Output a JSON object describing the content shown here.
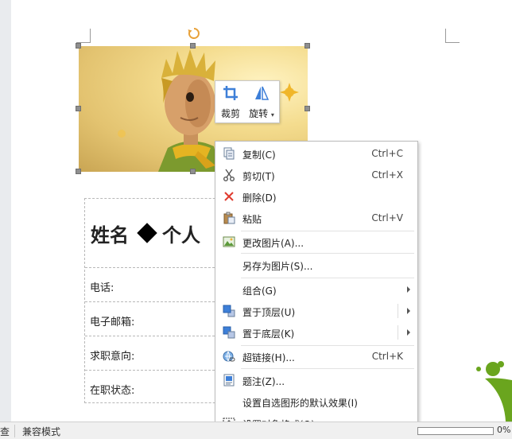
{
  "toolbar": {
    "crop_label": "裁剪",
    "rotate_label": "旋转"
  },
  "document": {
    "title_name": "姓名",
    "title_rest": "个人",
    "rows": [
      {
        "label": "电话:"
      },
      {
        "label": "电子邮箱:"
      },
      {
        "label": "求职意向:"
      },
      {
        "label": "在职状态:"
      }
    ]
  },
  "context_menu": {
    "items": [
      {
        "label": "复制(C)",
        "shortcut": "Ctrl+C",
        "icon": "copy-icon"
      },
      {
        "label": "剪切(T)",
        "shortcut": "Ctrl+X",
        "icon": "scissors-icon"
      },
      {
        "label": "删除(D)",
        "shortcut": "",
        "icon": "delete-x-icon"
      },
      {
        "label": "粘贴",
        "shortcut": "Ctrl+V",
        "icon": "paste-icon"
      },
      {
        "label": "更改图片(A)...",
        "shortcut": "",
        "icon": "change-picture-icon"
      },
      {
        "label": "另存为图片(S)...",
        "shortcut": "",
        "icon": ""
      },
      {
        "label": "组合(G)",
        "shortcut": "",
        "icon": ""
      },
      {
        "label": "置于顶层(U)",
        "shortcut": "",
        "icon": "bring-to-front-icon"
      },
      {
        "label": "置于底层(K)",
        "shortcut": "",
        "icon": "send-to-back-icon"
      },
      {
        "label": "超链接(H)...",
        "shortcut": "Ctrl+K",
        "icon": "hyperlink-icon"
      },
      {
        "label": "题注(Z)...",
        "shortcut": "",
        "icon": "caption-icon"
      },
      {
        "label": "设置自选图形的默认效果(I)",
        "shortcut": "",
        "icon": ""
      },
      {
        "label": "设置对象格式(O)...",
        "shortcut": "",
        "icon": "format-object-icon"
      }
    ]
  },
  "statusbar": {
    "left_fragment": "查",
    "mode": "兼容模式",
    "zoom_percent": "0%"
  },
  "colors": {
    "accent_blue": "#3d7fd8",
    "rotate_orange": "#e8a13a",
    "delete_red": "#e03b2f",
    "deco_green": "#6aa51e"
  }
}
